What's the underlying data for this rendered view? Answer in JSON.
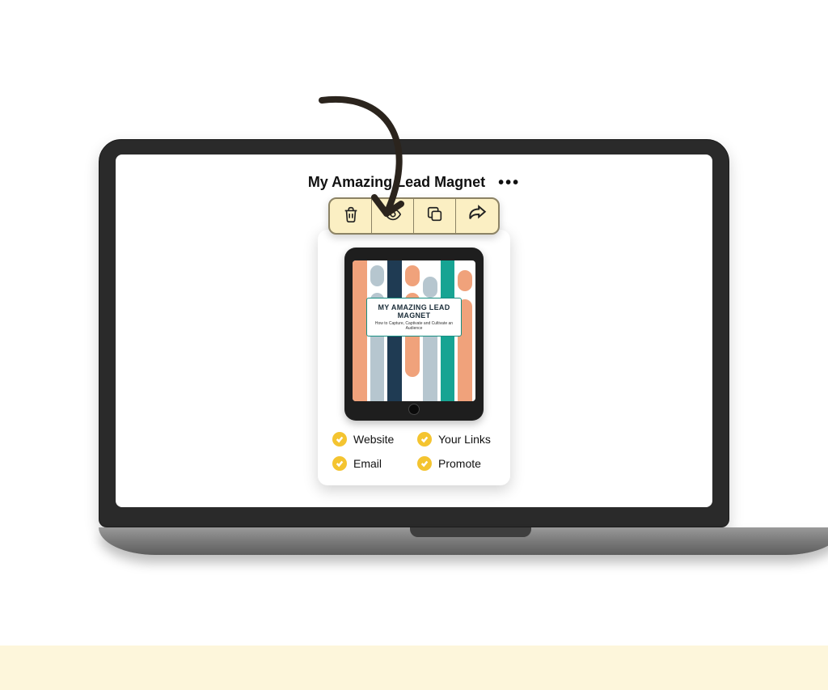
{
  "card": {
    "title": "My Amazing Lead Magnet",
    "cover": {
      "title": "MY AMAZING LEAD MAGNET",
      "subtitle": "How to Capture, Captivate and Cultivate an Audience"
    }
  },
  "actions": {
    "delete": "delete",
    "preview": "preview",
    "duplicate": "duplicate",
    "share": "share"
  },
  "statuses": [
    {
      "label": "Website"
    },
    {
      "label": "Your Links"
    },
    {
      "label": "Email"
    },
    {
      "label": "Promote"
    }
  ],
  "more_label": "•••"
}
